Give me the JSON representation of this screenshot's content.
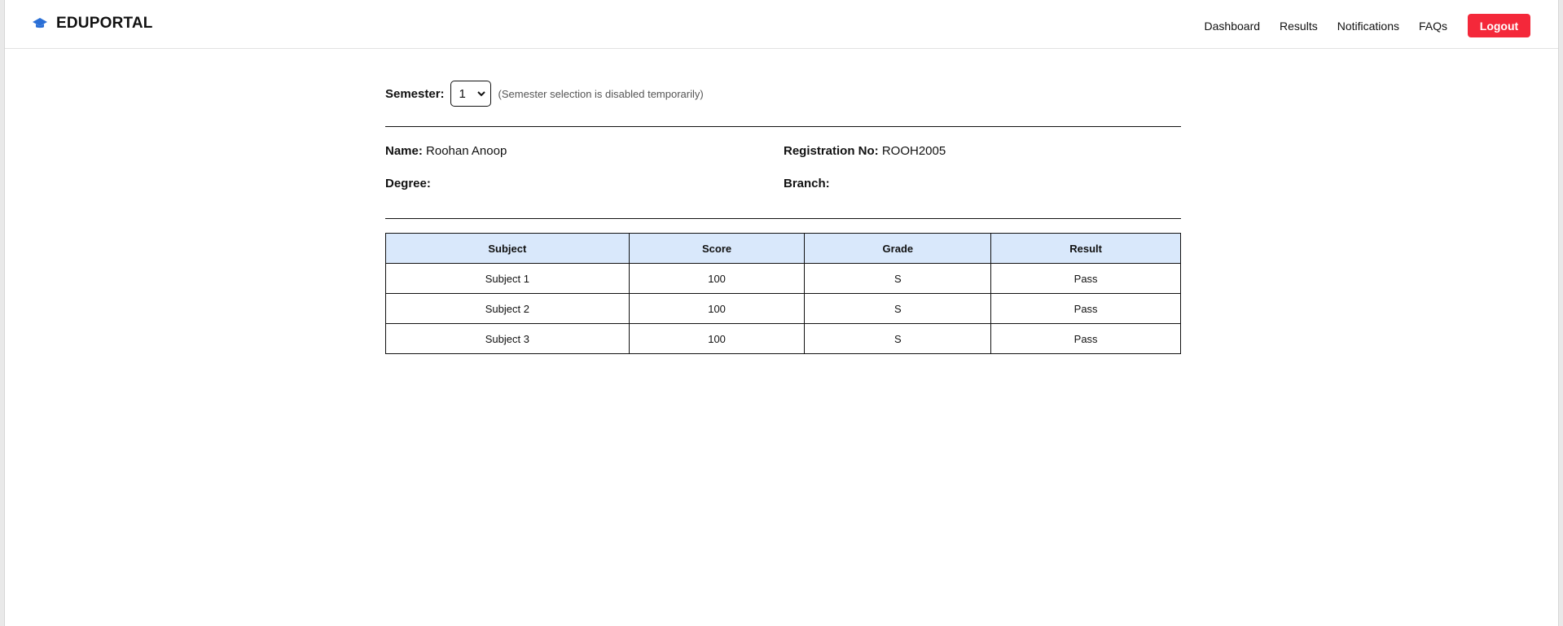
{
  "navbar": {
    "brand": "EDUPORTAL",
    "links": [
      "Dashboard",
      "Results",
      "Notifications",
      "FAQs"
    ],
    "logout_label": "Logout",
    "accent_color": "#f4283a",
    "brand_icon": "graduation-cap-icon"
  },
  "semester": {
    "label": "Semester:",
    "selected": "1",
    "note": "(Semester selection is disabled temporarily)"
  },
  "student": {
    "name_label": "Name:",
    "name": "Roohan Anoop",
    "reg_label": "Registration No:",
    "reg_no": "ROOH2005",
    "degree_label": "Degree:",
    "degree": "",
    "branch_label": "Branch:",
    "branch": ""
  },
  "results_table": {
    "headers": [
      "Subject",
      "Score",
      "Grade",
      "Result"
    ],
    "rows": [
      [
        "Subject 1",
        "100",
        "S",
        "Pass"
      ],
      [
        "Subject 2",
        "100",
        "S",
        "Pass"
      ],
      [
        "Subject 3",
        "100",
        "S",
        "Pass"
      ]
    ],
    "header_color": "#d9e8fb"
  }
}
